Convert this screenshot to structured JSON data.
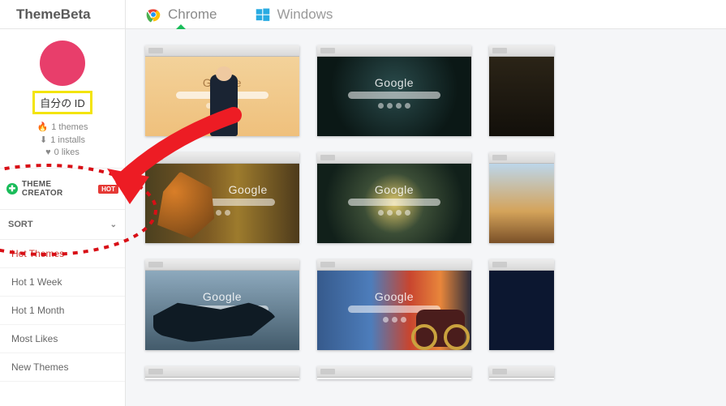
{
  "header": {
    "logo": "ThemeBeta",
    "tabs": [
      {
        "label": "Chrome",
        "icon": "chrome-icon",
        "active": true
      },
      {
        "label": "Windows",
        "icon": "windows-icon",
        "active": false
      }
    ]
  },
  "sidebar": {
    "profile": {
      "id_label": "自分の ID",
      "stats": {
        "themes": "1 themes",
        "installs": "1 installs",
        "likes": "0 likes"
      }
    },
    "theme_creator": {
      "label": "THEME CREATOR",
      "badge": "HOT"
    },
    "sort": {
      "header": "SORT",
      "items": [
        {
          "label": "Hot Themes",
          "selected": true
        },
        {
          "label": "Hot 1 Week",
          "selected": false
        },
        {
          "label": "Hot 1 Month",
          "selected": false
        },
        {
          "label": "Most Likes",
          "selected": false
        },
        {
          "label": "New Themes",
          "selected": false
        }
      ]
    }
  },
  "main": {
    "thumb_brand": "Google",
    "grid": [
      {
        "bg": "bg-a1",
        "figure": "anime"
      },
      {
        "bg": "bg-a2"
      },
      {
        "bg": "bg-a3",
        "clipped": true
      },
      {
        "bg": "bg-b1",
        "figure": "samus"
      },
      {
        "bg": "bg-b2"
      },
      {
        "bg": "bg-b3",
        "clipped": true
      },
      {
        "bg": "bg-c1",
        "figure": "whale"
      },
      {
        "bg": "bg-c2",
        "figure": "bike"
      },
      {
        "bg": "bg-c3",
        "clipped": true
      }
    ]
  },
  "annotation": {
    "arrow_color": "#ed1c24",
    "ellipse_color": "#d80f16",
    "highlight_color": "#f3e40c"
  }
}
